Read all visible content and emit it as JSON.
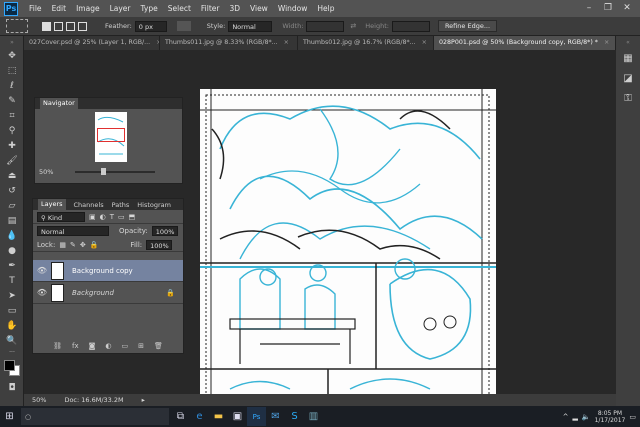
{
  "menubar": {
    "logo": "Ps",
    "items": [
      "File",
      "Edit",
      "Image",
      "Layer",
      "Type",
      "Select",
      "Filter",
      "3D",
      "View",
      "Window",
      "Help"
    ],
    "minimize": "–",
    "restore": "❐",
    "close": "✕"
  },
  "options": {
    "feather_label": "Feather:",
    "feather_value": "0 px",
    "style_label": "Style:",
    "style_value": "Normal",
    "width_label": "Width:",
    "height_label": "Height:",
    "refine_edge": "Refine Edge..."
  },
  "tabs": [
    {
      "label": "027Cover.psd @ 25% (Layer 1, RGB/..."
    },
    {
      "label": "Thumbs011.jpg @ 8.33% (RGB/8*..."
    },
    {
      "label": "Thumbs012.jpg @ 16.7% (RGB/8*..."
    },
    {
      "label": "028P001.psd @ 50% (Background copy, RGB/8*) *"
    }
  ],
  "navigator": {
    "title": "Navigator",
    "zoom": "50%"
  },
  "layers_panel": {
    "tabs": [
      "Layers",
      "Channels",
      "Paths",
      "Histogram"
    ],
    "kind": "Kind",
    "blend_mode": "Normal",
    "opacity_label": "Opacity:",
    "opacity_value": "100%",
    "lock_label": "Lock:",
    "fill_label": "Fill:",
    "fill_value": "100%",
    "layers": [
      {
        "name": "Background copy",
        "selected": true
      },
      {
        "name": "Background",
        "selected": false
      }
    ]
  },
  "status": {
    "zoom": "50%",
    "doc": "Doc: 16.6M/33.2M"
  },
  "taskbar": {
    "time": "8:05 PM",
    "date": "1/17/2017"
  },
  "colors": {
    "sketch_blue": "#39b4d6",
    "ink": "#222222",
    "selected_layer": "#7583a0"
  }
}
